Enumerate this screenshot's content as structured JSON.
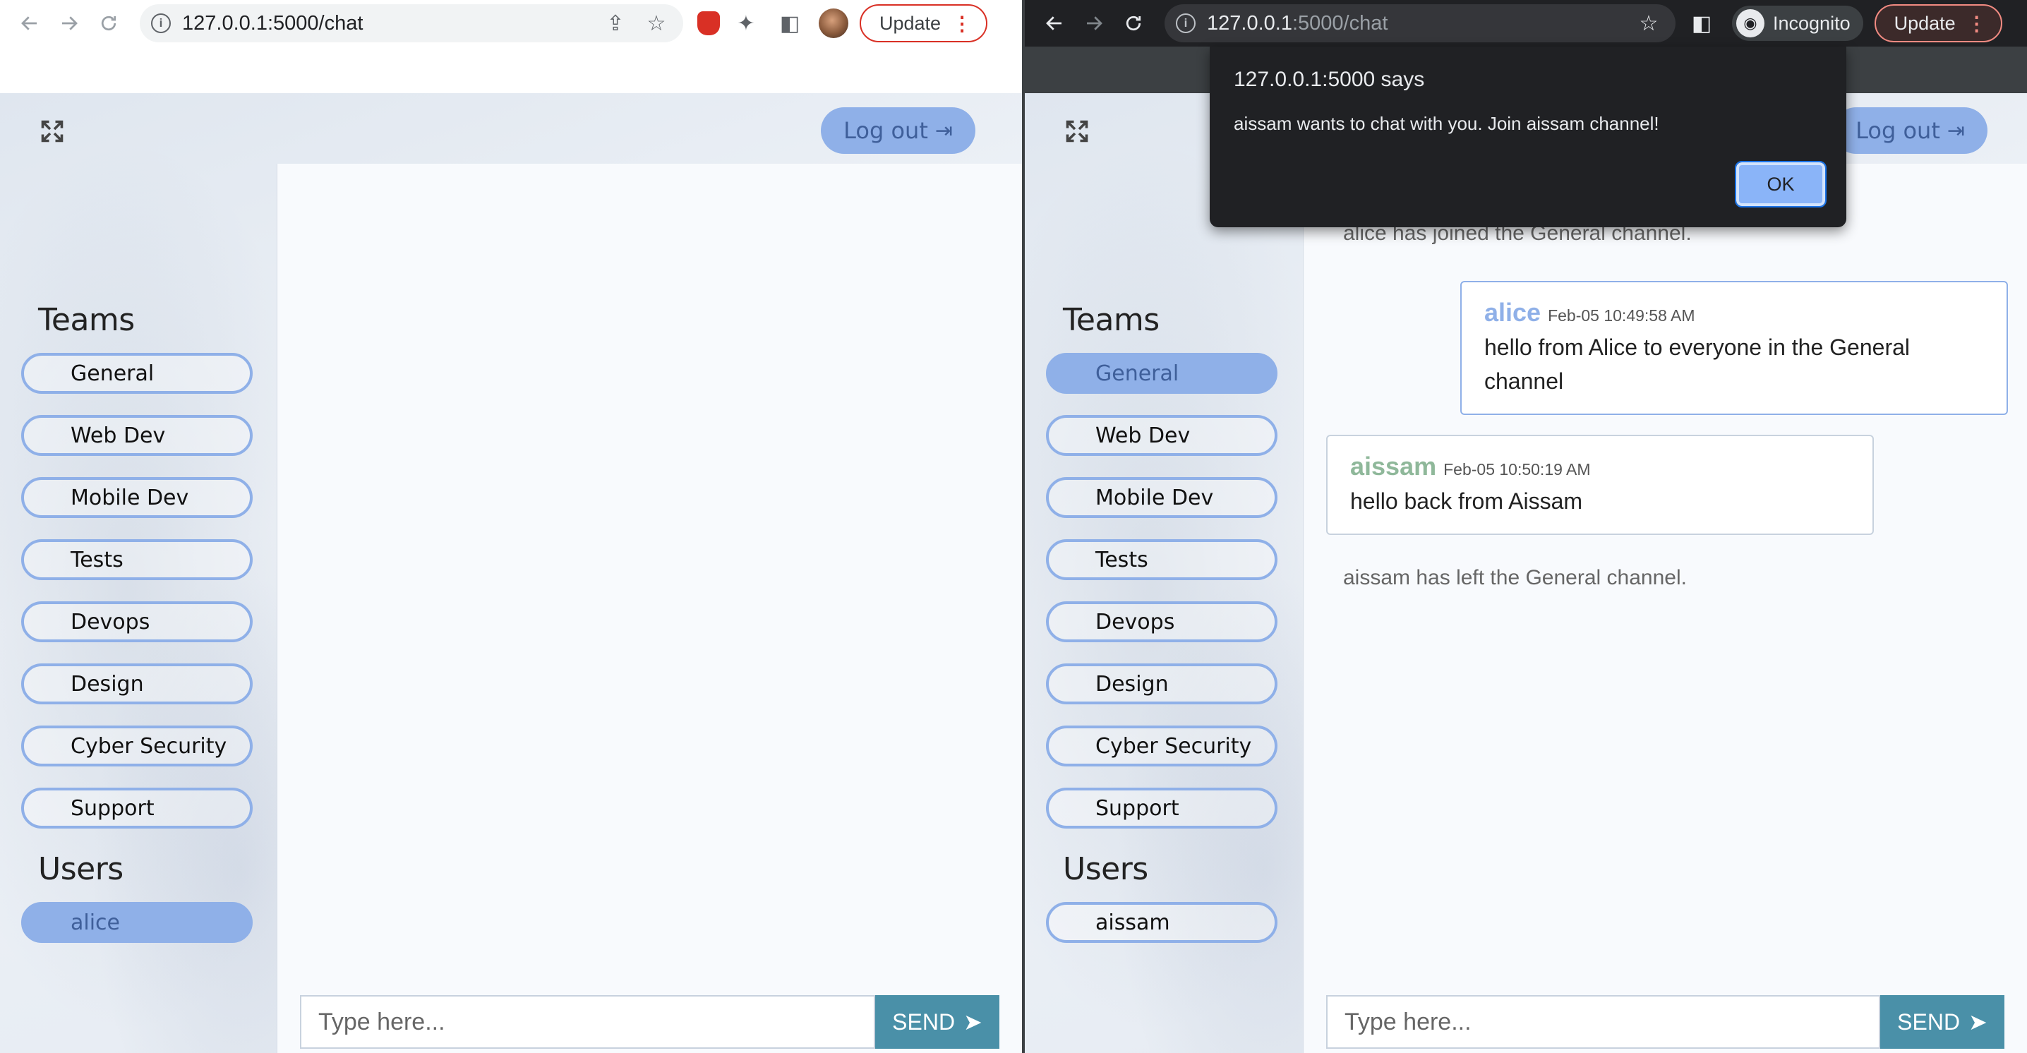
{
  "left_window": {
    "url": "127.0.0.1:5000/chat",
    "update_label": "Update",
    "logout_label": "Log out",
    "teams_title": "Teams",
    "teams": [
      "General",
      "Web Dev",
      "Mobile Dev",
      "Tests",
      "Devops",
      "Design",
      "Cyber Security",
      "Support"
    ],
    "users_title": "Users",
    "users": [
      "alice"
    ],
    "active_user": "alice",
    "input_placeholder": "Type here...",
    "send_label": "SEND"
  },
  "right_window": {
    "url_host": "127.0.0.1",
    "url_rest": ":5000/chat",
    "incognito_label": "Incognito",
    "update_label": "Update",
    "logout_label": "Log out",
    "teams_title": "Teams",
    "teams": [
      "General",
      "Web Dev",
      "Mobile Dev",
      "Tests",
      "Devops",
      "Design",
      "Cyber Security",
      "Support"
    ],
    "active_team": "General",
    "users_title": "Users",
    "users": [
      "aissam"
    ],
    "messages": {
      "sys_joined": "alice has joined the General channel.",
      "m1_user": "alice",
      "m1_time": "Feb-05 10:49:58 AM",
      "m1_text": "hello from Alice to everyone in the General channel",
      "m2_user": "aissam",
      "m2_time": "Feb-05 10:50:19 AM",
      "m2_text": "hello back from Aissam",
      "sys_left": "aissam has left the General channel."
    },
    "input_placeholder": "Type here...",
    "send_label": "SEND",
    "alert": {
      "title": "127.0.0.1:5000 says",
      "message": "aissam wants to chat with you. Join aissam channel!",
      "ok_label": "OK"
    }
  },
  "colors": {
    "accent": "#8fb0e8",
    "send": "#4a90a8",
    "alice": "#8fb0e8",
    "aissam": "#8fb89a"
  }
}
